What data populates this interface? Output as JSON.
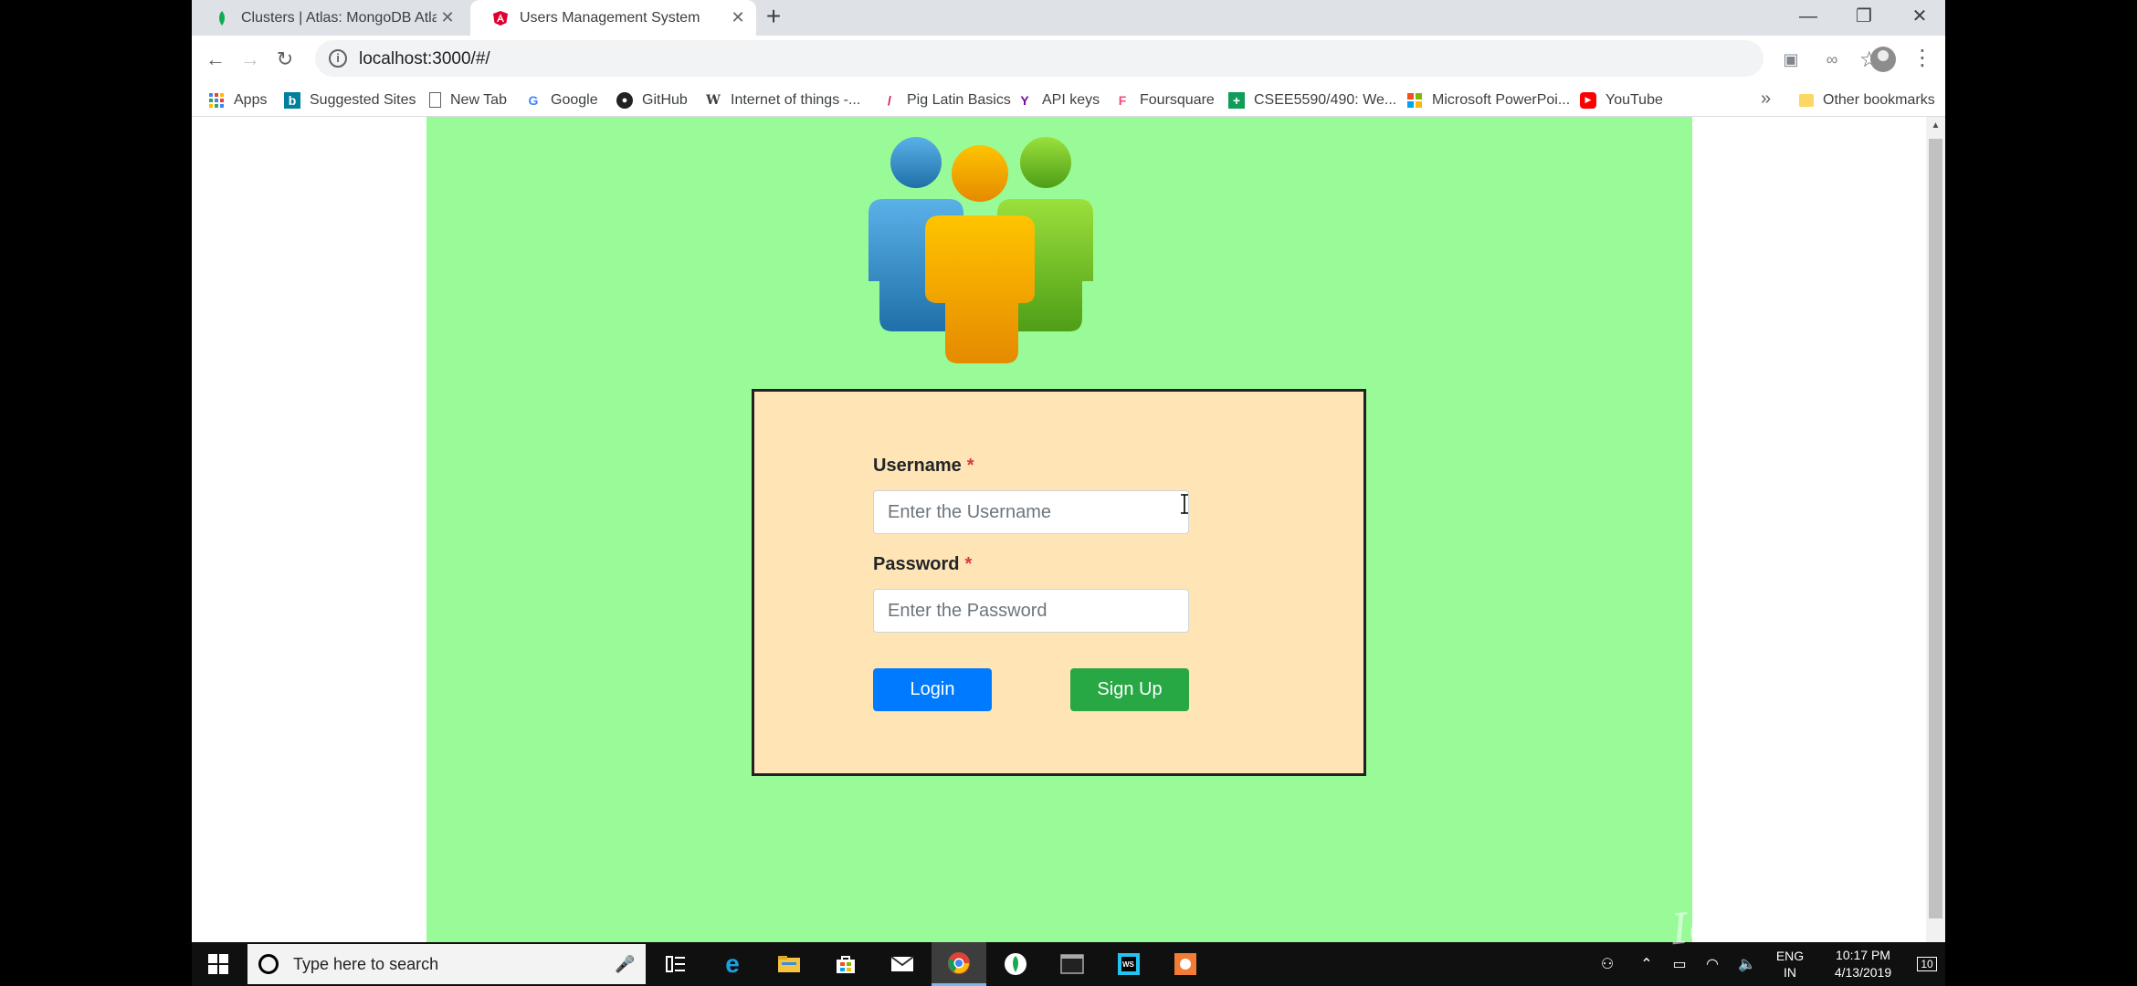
{
  "browser": {
    "tabs": [
      {
        "title": "Clusters | Atlas: MongoDB Atlas",
        "icon": "mongodb-leaf-icon"
      },
      {
        "title": "Users Management System",
        "icon": "angular-icon",
        "active": true
      }
    ],
    "url": "localhost:3000/#/",
    "bookmarks": [
      {
        "label": "Apps",
        "icon": "apps-grid-icon"
      },
      {
        "label": "Suggested Sites",
        "icon": "bing-icon"
      },
      {
        "label": "New Tab",
        "icon": "page-icon"
      },
      {
        "label": "Google",
        "icon": "google-icon"
      },
      {
        "label": "GitHub",
        "icon": "github-icon"
      },
      {
        "label": "Internet of things -...",
        "icon": "wikipedia-icon"
      },
      {
        "label": "Pig Latin Basics",
        "icon": "feather-icon"
      },
      {
        "label": "API keys",
        "icon": "yahoo-icon"
      },
      {
        "label": "Foursquare",
        "icon": "foursquare-icon"
      },
      {
        "label": "CSEE5590/490: We...",
        "icon": "sheets-icon"
      },
      {
        "label": "Microsoft PowerPoi...",
        "icon": "microsoft-icon"
      },
      {
        "label": "YouTube",
        "icon": "youtube-icon"
      }
    ],
    "other_bookmarks": "Other bookmarks"
  },
  "page": {
    "username_label": "Username",
    "username_placeholder": "Enter the Username",
    "password_label": "Password",
    "password_placeholder": "Enter the Password",
    "required_mark": "*",
    "login_button": "Login",
    "signup_button": "Sign Up",
    "colors": {
      "background": "#98fb98",
      "form_bg": "#ffe4b5",
      "login": "#007bff",
      "signup": "#28a745"
    }
  },
  "taskbar": {
    "search_placeholder": "Type here to search",
    "lang_top": "ENG",
    "lang_bottom": "IN",
    "time": "10:17 PM",
    "date": "4/13/2019",
    "notification_count": "10",
    "watermark": "Icecream"
  }
}
